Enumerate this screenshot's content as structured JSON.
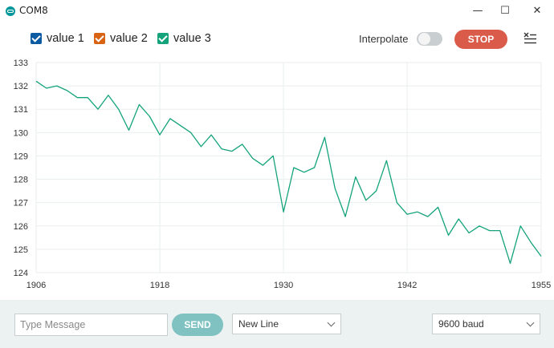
{
  "window": {
    "title": "COM8",
    "minimize_glyph": "—",
    "maximize_glyph": "☐",
    "close_glyph": "✕"
  },
  "legend": [
    {
      "label": "value 1",
      "color": "#0b5ba3"
    },
    {
      "label": "value 2",
      "color": "#d86313"
    },
    {
      "label": "value 3",
      "color": "#14a37b"
    }
  ],
  "toolbar": {
    "interpolate_label": "Interpolate",
    "interpolate_on": false,
    "stop_label": "STOP",
    "menu_icon": "clear-list-icon"
  },
  "chart_data": {
    "type": "line",
    "xlim": [
      1906,
      1955
    ],
    "ylim": [
      124,
      133
    ],
    "x_ticks": [
      "1906",
      "1918",
      "1930",
      "1942",
      "1955"
    ],
    "y_ticks": [
      "124",
      "125",
      "126",
      "127",
      "128",
      "129",
      "130",
      "131",
      "132",
      "133"
    ],
    "grid": true,
    "series": [
      {
        "color": "#14a37b",
        "x": [
          1906,
          1907,
          1908,
          1909,
          1910,
          1911,
          1912,
          1913,
          1914,
          1915,
          1916,
          1917,
          1918,
          1919,
          1920,
          1921,
          1922,
          1923,
          1924,
          1925,
          1926,
          1927,
          1928,
          1929,
          1930,
          1931,
          1932,
          1933,
          1934,
          1935,
          1936,
          1937,
          1938,
          1939,
          1940,
          1941,
          1942,
          1943,
          1944,
          1945,
          1946,
          1947,
          1948,
          1949,
          1950,
          1951,
          1952,
          1953,
          1954,
          1955
        ],
        "y": [
          132.2,
          131.9,
          132.0,
          131.8,
          131.5,
          131.5,
          131.0,
          131.6,
          131.0,
          130.1,
          131.2,
          130.7,
          129.9,
          130.6,
          130.3,
          130.0,
          129.4,
          129.9,
          129.3,
          129.2,
          129.5,
          128.9,
          128.6,
          129.0,
          126.6,
          128.5,
          128.3,
          128.5,
          129.8,
          127.6,
          126.4,
          128.1,
          127.1,
          127.5,
          128.8,
          127.0,
          126.5,
          126.6,
          126.4,
          126.8,
          125.6,
          126.3,
          125.7,
          126.0,
          125.8,
          125.8,
          124.4,
          126.0,
          125.3,
          124.7
        ]
      }
    ]
  },
  "bottom": {
    "message_placeholder": "Type Message",
    "send_label": "SEND",
    "line_ending": "New Line",
    "baud": "9600 baud"
  }
}
